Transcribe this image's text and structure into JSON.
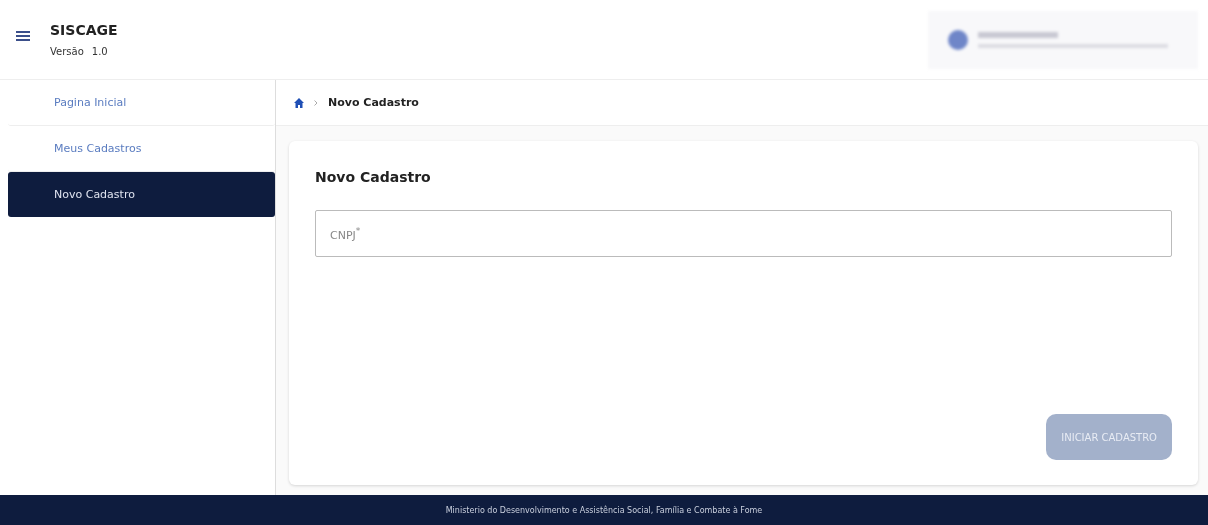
{
  "header": {
    "title": "SISCAGE",
    "version_label": "Versão",
    "version": "1.0"
  },
  "sidebar": {
    "items": [
      {
        "label": "Pagina Inicial",
        "selected": false
      },
      {
        "label": "Meus Cadastros",
        "selected": false
      },
      {
        "label": "Novo Cadastro",
        "selected": true
      }
    ]
  },
  "breadcrumb": {
    "current": "Novo Cadastro"
  },
  "form": {
    "title": "Novo Cadastro",
    "field": {
      "label": "CNPJ$^{*}$"
    },
    "button": {
      "label": "INICIAR CADASTRO",
      "disabled": true
    }
  },
  "footer": {
    "text": "Ministerio do Desenvolvimento e Assistência Social, Família e Combate à Fome"
  }
}
